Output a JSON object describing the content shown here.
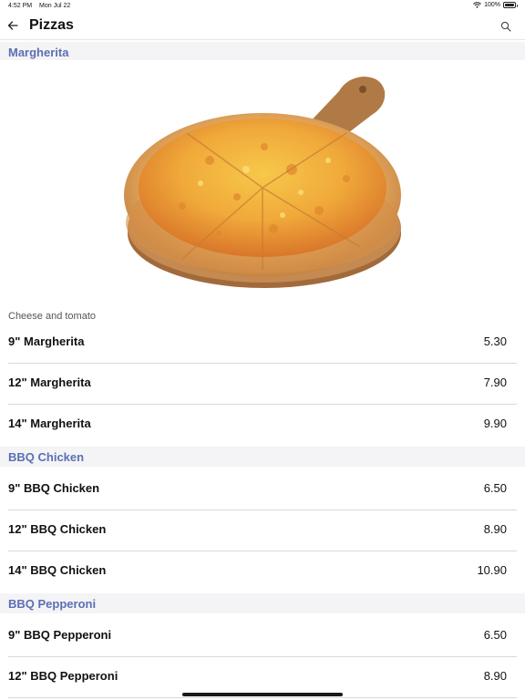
{
  "status": {
    "time": "4:52 PM",
    "date": "Mon Jul 22",
    "battery": "100%",
    "battery_level": 1.0
  },
  "nav": {
    "title": "Pizzas"
  },
  "icons": {
    "back": "arrow-left-icon",
    "search": "search-icon",
    "wifi": "wifi-icon",
    "battery": "battery-icon"
  },
  "colors": {
    "section_header_text": "#5b6fb3",
    "section_header_bg": "#f4f4f6"
  },
  "sections": [
    {
      "title": "Margherita",
      "description": "Cheese and tomato",
      "items": [
        {
          "name": "9\" Margherita",
          "price": "5.30"
        },
        {
          "name": "12\" Margherita",
          "price": "7.90"
        },
        {
          "name": "14\" Margherita",
          "price": "9.90"
        }
      ]
    },
    {
      "title": "BBQ Chicken",
      "items": [
        {
          "name": "9\" BBQ Chicken",
          "price": "6.50"
        },
        {
          "name": "12\" BBQ Chicken",
          "price": "8.90"
        },
        {
          "name": "14\" BBQ Chicken",
          "price": "10.90"
        }
      ]
    },
    {
      "title": "BBQ Pepperoni",
      "items": [
        {
          "name": "9\" BBQ Pepperoni",
          "price": "6.50"
        },
        {
          "name": "12\" BBQ Pepperoni",
          "price": "8.90"
        }
      ]
    }
  ]
}
